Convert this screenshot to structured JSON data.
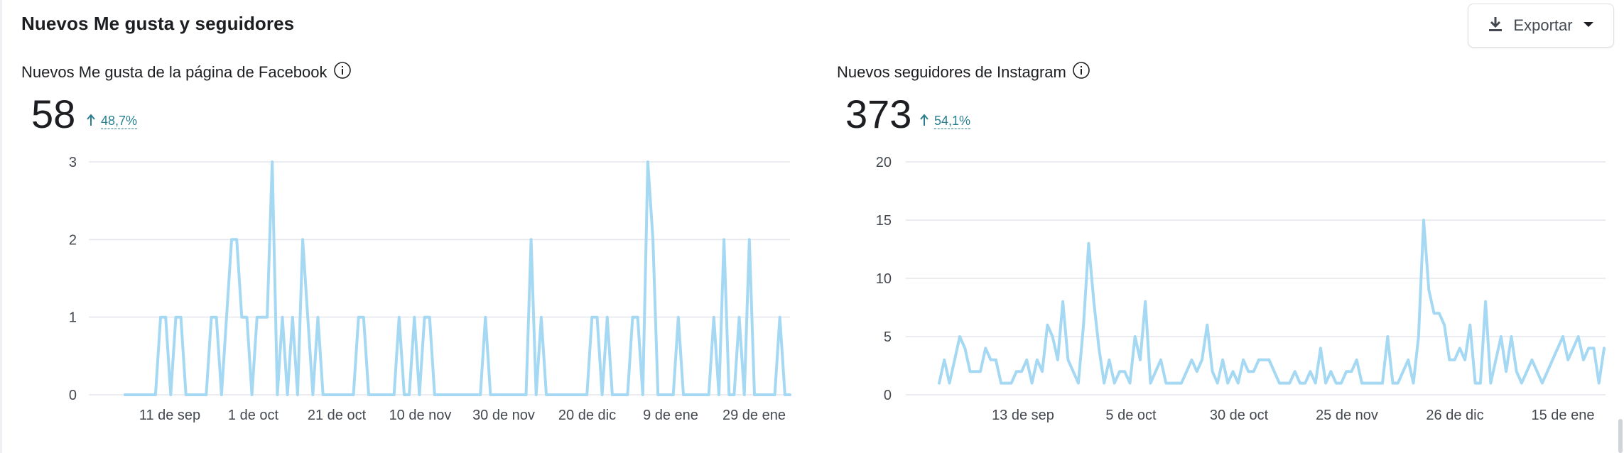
{
  "section": {
    "title": "Nuevos Me gusta y seguidores"
  },
  "export": {
    "label": "Exportar",
    "icon": "download-icon"
  },
  "facebook": {
    "title": "Nuevos Me gusta de la página de Facebook",
    "total": "58",
    "change": "48,7%",
    "change_direction": "up"
  },
  "instagram": {
    "title": "Nuevos seguidores de Instagram",
    "total": "373",
    "change": "54,1%",
    "change_direction": "up"
  },
  "colors": {
    "line": "#a5d8f3",
    "grid": "#e4e6eb",
    "delta": "#2a7f8f"
  },
  "chart_data": [
    {
      "type": "line",
      "title": "Nuevos Me gusta de la página de Facebook",
      "ylim": [
        0,
        3
      ],
      "yticks": [
        0,
        1,
        2,
        3
      ],
      "xtick_labels": [
        "11 de sep",
        "1 de oct",
        "21 de oct",
        "10 de nov",
        "30 de nov",
        "20 de dic",
        "9 de ene",
        "29 de ene"
      ],
      "values": [
        0,
        0,
        0,
        0,
        0,
        0,
        0,
        1,
        1,
        0,
        1,
        1,
        0,
        0,
        0,
        0,
        0,
        1,
        1,
        0,
        1,
        2,
        2,
        1,
        1,
        0,
        1,
        1,
        1,
        3,
        0,
        1,
        0,
        1,
        0,
        2,
        1,
        0,
        1,
        0,
        0,
        0,
        0,
        0,
        0,
        0,
        1,
        1,
        0,
        0,
        0,
        0,
        0,
        0,
        1,
        0,
        0,
        1,
        0,
        1,
        1,
        0,
        0,
        0,
        0,
        0,
        0,
        0,
        0,
        0,
        0,
        1,
        0,
        0,
        0,
        0,
        0,
        0,
        0,
        0,
        2,
        0,
        1,
        0,
        0,
        0,
        0,
        0,
        0,
        0,
        0,
        0,
        1,
        1,
        0,
        1,
        0,
        0,
        0,
        0,
        1,
        1,
        0,
        3,
        2,
        0,
        0,
        0,
        0,
        1,
        0,
        0,
        0,
        0,
        0,
        0,
        1,
        0,
        2,
        0,
        0,
        1,
        0,
        2,
        0,
        0,
        0,
        0,
        0,
        1,
        0,
        0
      ]
    },
    {
      "type": "line",
      "title": "Nuevos seguidores de Instagram",
      "ylim": [
        0,
        20
      ],
      "yticks": [
        0,
        5,
        10,
        15,
        20
      ],
      "xtick_labels": [
        "13 de sep",
        "5 de oct",
        "30 de oct",
        "25 de nov",
        "26 de dic",
        "15 de ene"
      ],
      "values": [
        1,
        3,
        1,
        3,
        5,
        4,
        2,
        2,
        2,
        4,
        3,
        3,
        1,
        1,
        1,
        2,
        2,
        3,
        1,
        3,
        2,
        6,
        5,
        3,
        8,
        3,
        2,
        1,
        6,
        13,
        8,
        4,
        1,
        3,
        1,
        2,
        2,
        1,
        5,
        3,
        8,
        1,
        2,
        3,
        1,
        1,
        1,
        1,
        2,
        3,
        2,
        3,
        6,
        2,
        1,
        3,
        1,
        2,
        1,
        3,
        2,
        2,
        3,
        3,
        3,
        2,
        1,
        1,
        1,
        2,
        1,
        1,
        2,
        1,
        4,
        1,
        2,
        1,
        1,
        2,
        2,
        3,
        1,
        1,
        1,
        1,
        1,
        5,
        1,
        1,
        2,
        3,
        1,
        5,
        15,
        9,
        7,
        7,
        6,
        3,
        3,
        4,
        3,
        6,
        1,
        1,
        8,
        1,
        3,
        5,
        2,
        5,
        2,
        1,
        2,
        3,
        2,
        1,
        2,
        3,
        4,
        5,
        3,
        4,
        5,
        3,
        4,
        4,
        1,
        4
      ]
    }
  ]
}
